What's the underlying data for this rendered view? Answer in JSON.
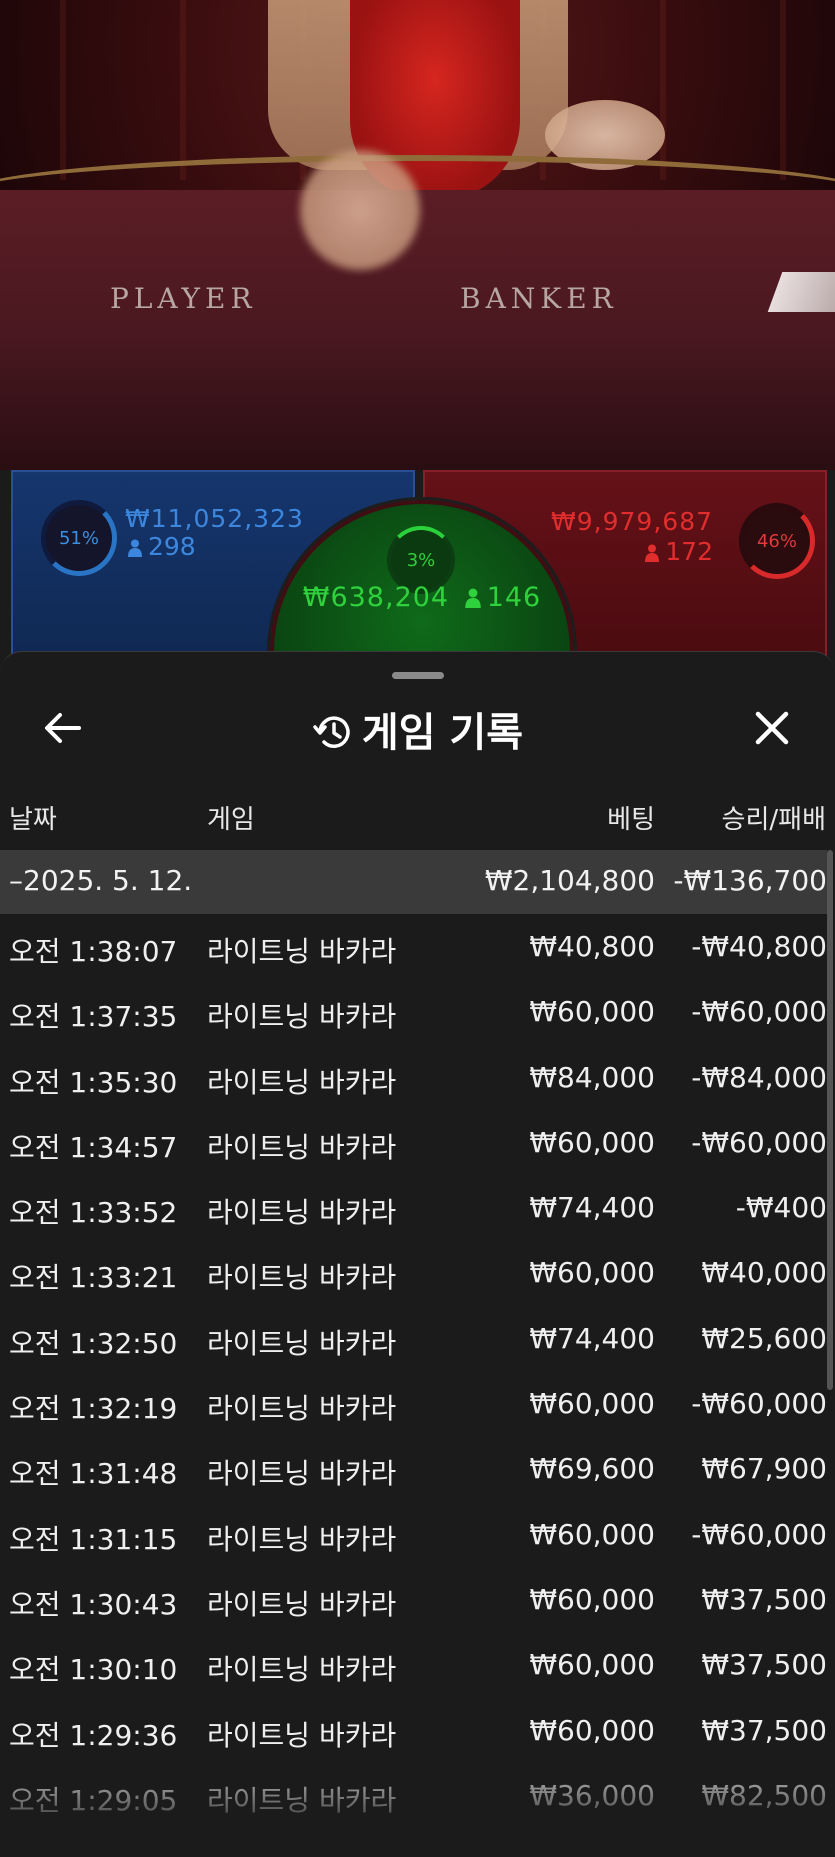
{
  "video": {
    "player_label": "PLAYER",
    "banker_label": "BANKER"
  },
  "stats": {
    "player": {
      "percent_text": "51%",
      "percent": 51,
      "amount": "₩11,052,323",
      "players": "298",
      "color": "#3c87dd"
    },
    "tie": {
      "percent_text": "3%",
      "percent": 3,
      "amount": "₩638,204",
      "players": "146",
      "color": "#2fd13d"
    },
    "banker": {
      "percent_text": "46%",
      "percent": 46,
      "amount": "₩9,979,687",
      "players": "172",
      "color": "#e02d2d"
    }
  },
  "sheet": {
    "title": "게임 기록",
    "back_icon": "arrow-left-icon",
    "close_icon": "close-icon",
    "title_icon": "history-icon",
    "columns": {
      "date": "날짜",
      "game": "게임",
      "bet": "베팅",
      "win_loss": "승리/패배"
    },
    "day": {
      "date": "2025. 5. 12.",
      "bet_total": "₩2,104,800",
      "win_loss_total": "-₩136,700"
    },
    "rows": [
      {
        "time": "오전 1:38:07",
        "game": "라이트닝 바카라",
        "bet": "₩40,800",
        "result": "-₩40,800"
      },
      {
        "time": "오전 1:37:35",
        "game": "라이트닝 바카라",
        "bet": "₩60,000",
        "result": "-₩60,000"
      },
      {
        "time": "오전 1:35:30",
        "game": "라이트닝 바카라",
        "bet": "₩84,000",
        "result": "-₩84,000"
      },
      {
        "time": "오전 1:34:57",
        "game": "라이트닝 바카라",
        "bet": "₩60,000",
        "result": "-₩60,000"
      },
      {
        "time": "오전 1:33:52",
        "game": "라이트닝 바카라",
        "bet": "₩74,400",
        "result": "-₩400"
      },
      {
        "time": "오전 1:33:21",
        "game": "라이트닝 바카라",
        "bet": "₩60,000",
        "result": "₩40,000"
      },
      {
        "time": "오전 1:32:50",
        "game": "라이트닝 바카라",
        "bet": "₩74,400",
        "result": "₩25,600"
      },
      {
        "time": "오전 1:32:19",
        "game": "라이트닝 바카라",
        "bet": "₩60,000",
        "result": "-₩60,000"
      },
      {
        "time": "오전 1:31:48",
        "game": "라이트닝 바카라",
        "bet": "₩69,600",
        "result": "₩67,900"
      },
      {
        "time": "오전 1:31:15",
        "game": "라이트닝 바카라",
        "bet": "₩60,000",
        "result": "-₩60,000"
      },
      {
        "time": "오전 1:30:43",
        "game": "라이트닝 바카라",
        "bet": "₩60,000",
        "result": "₩37,500"
      },
      {
        "time": "오전 1:30:10",
        "game": "라이트닝 바카라",
        "bet": "₩60,000",
        "result": "₩37,500"
      },
      {
        "time": "오전 1:29:36",
        "game": "라이트닝 바카라",
        "bet": "₩60,000",
        "result": "₩37,500"
      },
      {
        "time": "오전 1:29:05",
        "game": "라이트닝 바카라",
        "bet": "₩36,000",
        "result": "₩82,500"
      }
    ]
  }
}
